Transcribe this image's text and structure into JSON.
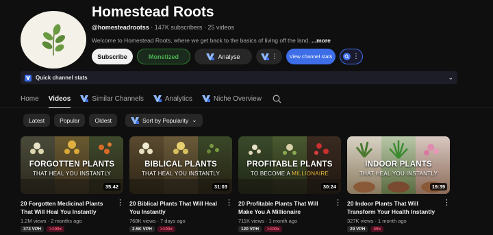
{
  "channel": {
    "name": "Homestead Roots",
    "handle": "@homesteadrootss",
    "subscribers": "147K subscribers",
    "videos_count": "25 videos",
    "separator": " · ",
    "description": "Welcome to Homestead Roots, where we get back to the basics of living off the land.",
    "more_label": "...more"
  },
  "actions": {
    "subscribe": "Subscribe",
    "monetized": "Monetized",
    "analyse": "Analyse",
    "view_stats": "View channel stats"
  },
  "quick_stats": {
    "label": "Quick channel stats"
  },
  "tabs": [
    {
      "label": "Home"
    },
    {
      "label": "Videos"
    },
    {
      "label": "Similar Channels"
    },
    {
      "label": "Analytics"
    },
    {
      "label": "Niche Overview"
    }
  ],
  "filters": {
    "latest": "Latest",
    "popular": "Popular",
    "oldest": "Oldest",
    "sort": "Sort by Popularity"
  },
  "videos": [
    {
      "thumb_title": "FORGOTTEN PLANTS",
      "thumb_sub": "THAT HEAL YOU INSTANTLY",
      "duration": "35:42",
      "title": "20 Forgotten Medicinal Plants That Will Heal You Instantly",
      "views": "1.2M views",
      "age": "2 months ago",
      "vph": "373 VPH",
      "outlier": ">100x"
    },
    {
      "thumb_title": "BIBLICAL PLANTS",
      "thumb_sub": "THAT HEAL YOU INSTANTLY",
      "duration": "31:03",
      "title": "20 Biblical Plants That Will Heal You Instantly",
      "views": "768K views",
      "age": "7 days ago",
      "vph": "2.5K VPH",
      "outlier": ">100x"
    },
    {
      "thumb_title": "PROFITABLE PLANTS",
      "thumb_sub_a": "TO BECOME A ",
      "thumb_sub_b": "MILLIONAIRE",
      "duration": "30:24",
      "title": "20 Profitable Plants That Will Make You A Millionaire",
      "views": "711K views",
      "age": "1 month ago",
      "vph": "120 VPH",
      "outlier": ">100x"
    },
    {
      "thumb_title": "INDOOR PLANTS",
      "thumb_sub": "THAT HEAL YOU INSTANTLY",
      "duration": "19:39",
      "title": "20 Indoor Plants That Will Transform Your Health Instantly",
      "views": "327K views",
      "age": "1 month ago",
      "vph": "29 VPH",
      "outlier": "49x"
    }
  ],
  "colors": {
    "background": "#0f0f0f",
    "accent_blue": "#3d6ee8",
    "monetized_green": "#4caf50",
    "outlier_pink": "#ff5c7c"
  }
}
